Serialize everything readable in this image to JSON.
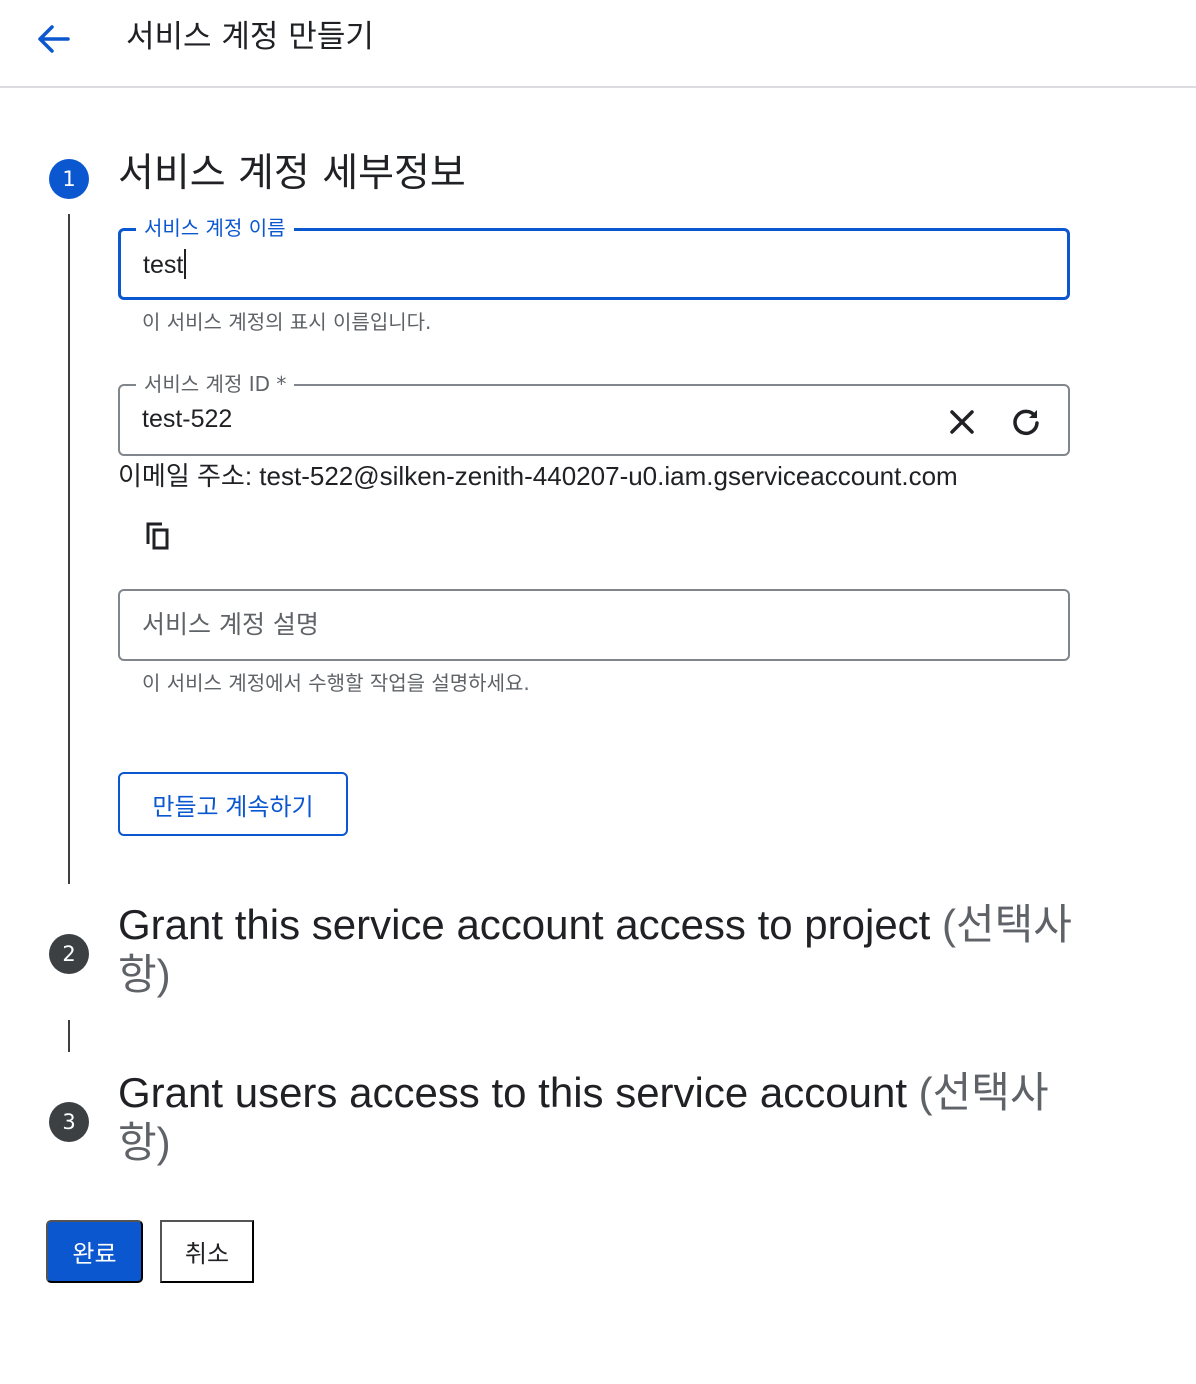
{
  "header": {
    "title": "서비스 계정 만들기",
    "back_icon": "arrow-back-icon"
  },
  "steps": [
    {
      "number": "1",
      "title": "서비스 계정 세부정보",
      "state": "active"
    },
    {
      "number": "2",
      "title": "Grant this service account access to project",
      "optional": "(선택사항)",
      "state": "inactive"
    },
    {
      "number": "3",
      "title": "Grant users access to this service account",
      "optional": "(선택사항)",
      "state": "inactive"
    }
  ],
  "form": {
    "name_field": {
      "label": "서비스 계정 이름",
      "value": "test",
      "hint": "이 서비스 계정의 표시 이름입니다."
    },
    "id_field": {
      "label": "서비스 계정 ID *",
      "value": "test-522",
      "clear_icon": "close-icon",
      "refresh_icon": "refresh-icon"
    },
    "email": {
      "label": "이메일 주소:",
      "value": "test-522@silken-zenith-440207-u0.iam.gserviceaccount.com",
      "copy_icon": "copy-icon"
    },
    "description_field": {
      "placeholder": "서비스 계정 설명",
      "value": "",
      "hint": "이 서비스 계정에서 수행할 작업을 설명하세요."
    },
    "create_continue_label": "만들고 계속하기"
  },
  "footer": {
    "done_label": "완료",
    "cancel_label": "취소"
  },
  "colors": {
    "accent": "#0b57d0",
    "inactive_step": "#3c4043",
    "hint_text": "#5f6368"
  }
}
